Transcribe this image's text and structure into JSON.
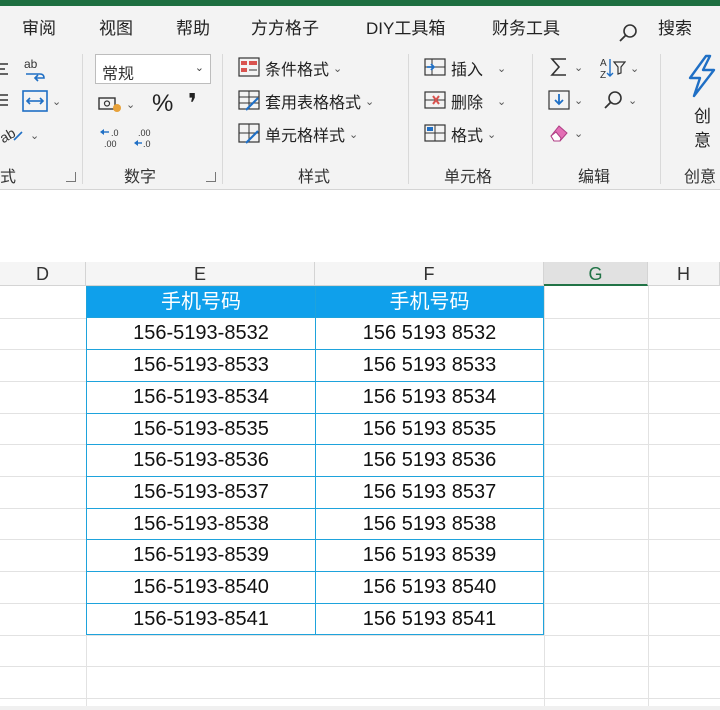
{
  "menu_tabs": [
    "审阅",
    "视图",
    "帮助",
    "方方格子",
    "DIY工具箱",
    "财务工具",
    "搜索"
  ],
  "ribbon": {
    "number_format_value": "常规",
    "percent_symbol": "%",
    "comma_symbol": "❜",
    "styles": {
      "conditional_format": "条件格式",
      "table_format": "套用表格格式",
      "cell_style": "单元格样式"
    },
    "cells": {
      "insert": "插入",
      "delete": "删除",
      "format": "格式"
    },
    "create_label_line1": "创",
    "create_label_line2": "意",
    "group_labels": {
      "alignment_partial": "式",
      "number": "数字",
      "styles": "样式",
      "cells": "单元格",
      "editing": "编辑",
      "creative": "创意"
    }
  },
  "columns": [
    "D",
    "E",
    "F",
    "G",
    "H"
  ],
  "table": {
    "header_e": "手机号码",
    "header_f": "手机号码",
    "rows": [
      [
        "156-5193-8532",
        "156 5193 8532"
      ],
      [
        "156-5193-8533",
        "156 5193 8533"
      ],
      [
        "156-5193-8534",
        "156 5193 8534"
      ],
      [
        "156-5193-8535",
        "156 5193 8535"
      ],
      [
        "156-5193-8536",
        "156 5193 8536"
      ],
      [
        "156-5193-8537",
        "156 5193 8537"
      ],
      [
        "156-5193-8538",
        "156 5193 8538"
      ],
      [
        "156-5193-8539",
        "156 5193 8539"
      ],
      [
        "156-5193-8540",
        "156 5193 8540"
      ],
      [
        "156-5193-8541",
        "156 5193 8541"
      ]
    ]
  },
  "colors": {
    "excel_green": "#1e6f41",
    "header_fill": "#0fa0eb",
    "table_border": "#1ea3dc"
  }
}
